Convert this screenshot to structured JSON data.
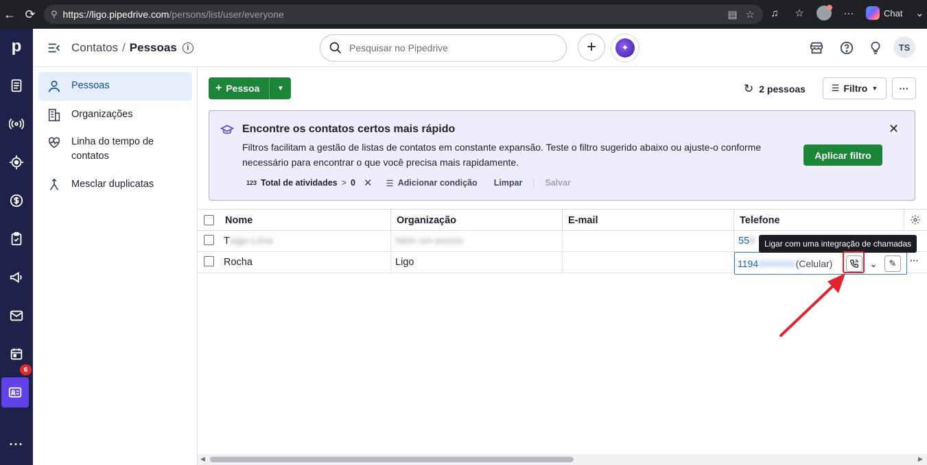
{
  "browser": {
    "url_host": "https://ligo.pipedrive.com",
    "url_path": "/persons/list/user/everyone",
    "chat_label": "Chat"
  },
  "rail": {
    "logo": "p",
    "badge_count": "6"
  },
  "header": {
    "breadcrumb_parent": "Contatos",
    "breadcrumb_sep": "/",
    "breadcrumb_current": "Pessoas",
    "search_placeholder": "Pesquisar no Pipedrive",
    "user_initials": "TS"
  },
  "sidebar": {
    "items": [
      {
        "label": "Pessoas"
      },
      {
        "label": "Organizações"
      },
      {
        "label": "Linha do tempo de contatos"
      },
      {
        "label": "Mesclar duplicatas"
      }
    ]
  },
  "toolbar": {
    "add_label": "Pessoa",
    "count_label": "2 pessoas",
    "filter_label": "Filtro",
    "more_label": "···"
  },
  "banner": {
    "title": "Encontre os contatos certos mais rápido",
    "text": "Filtros facilitam a gestão de listas de contatos em constante expansão. Teste o filtro sugerido abaixo ou ajuste-o conforme necessário para encontrar o que você precisa mais rapidamente.",
    "apply_label": "Aplicar filtro",
    "chip_icon_text": "123",
    "chip_label": "Total de atividades",
    "chip_op": ">",
    "chip_value": "0",
    "add_condition": "Adicionar condição",
    "clear": "Limpar",
    "save": "Salvar"
  },
  "table": {
    "columns": [
      "Nome",
      "Organização",
      "E-mail",
      "Telefone"
    ],
    "rows": [
      {
        "name": "T",
        "name_blurred": "iago Lima",
        "org_blurred": "Nem um pouco",
        "email": "",
        "phone": "55",
        "phone_blurred": " 8"
      },
      {
        "name": "Rocha",
        "org": "Ligo",
        "email": "",
        "phone": "1194",
        "phone_blurred": "0000000",
        "phone_type": "(Celular)"
      }
    ]
  },
  "tooltip": {
    "text": "Ligar com uma integração de chamadas"
  },
  "colors": {
    "rail": "#1f2248",
    "accent": "#5f43e9",
    "green": "#1b8637",
    "link": "#0b63c7",
    "callout": "#e5232c"
  }
}
